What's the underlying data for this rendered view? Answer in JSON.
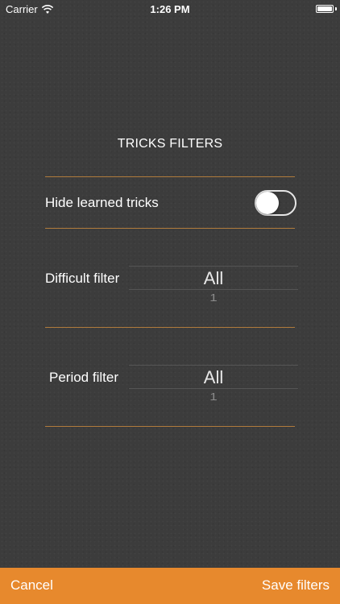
{
  "status_bar": {
    "carrier": "Carrier",
    "time": "1:26 PM",
    "wifi_icon": "wifi-icon",
    "battery_icon": "battery-icon"
  },
  "title": "TRICKS FILTERS",
  "hide_learned": {
    "label": "Hide learned tricks",
    "state": "off"
  },
  "difficult_filter": {
    "label": "Difficult filter",
    "selected": "All",
    "next": "1"
  },
  "period_filter": {
    "label": "Period filter",
    "selected": "All",
    "next": "1"
  },
  "bottom_bar": {
    "cancel": "Cancel",
    "save": "Save filters"
  },
  "colors": {
    "background": "#3c3c3c",
    "accent": "#e7892d",
    "divider": "#b07b3c"
  }
}
